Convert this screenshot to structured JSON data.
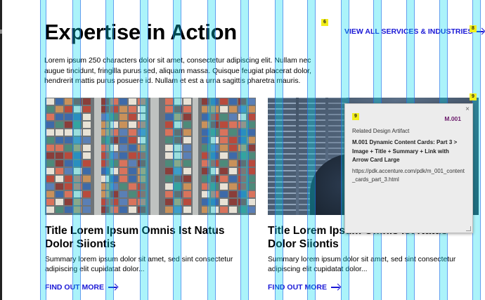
{
  "page": {
    "heading": "Expertise in Action",
    "view_all_label": "VIEW ALL SERVICES & INDUSTRIES",
    "intro": "Lorem ipsum 250 characters dolor sit amet, consectetur adipiscing elit. Nullam nec augue tincidunt, fringilla purus sed, aliquam massa. Quisque feugiat placerat dolor, hendrerit mattis purus posuere id. Nullam et est a urna sagittis pharetra mauris."
  },
  "cards": [
    {
      "title": "Title Lorem Ipsum Omnis Ist Natus Dolor Siiontis",
      "summary": "Summary lorem ipsum dolor sit amet, sed sint consectetur adipiscing elit cupidatat dolor...",
      "link_label": "FIND OUT MORE",
      "image": "shipping-containers-aerial"
    },
    {
      "title": "Title Lorem Ipsum Omnis Ist Natus Dolor Siiontis",
      "summary": "Summary lorem ipsum dolor sit amet, sed sint consectetur adipiscing elit cupidatat dolor...",
      "link_label": "FIND OUT MORE",
      "image": "city-buildings-person"
    }
  ],
  "annotations": {
    "badges": [
      "6",
      "8",
      "9"
    ],
    "artifact": {
      "badge": "9",
      "code": "M.001",
      "label": "Related Design Artifact",
      "name": "M.001 Dynamic Content Cards: Part 3 > Image + Title + Summary + Link with Arrow Card Large",
      "url": "https://pdk.accenture.com/pdk/m_001_content_cards_part_3.html",
      "close_glyph": "×"
    }
  },
  "colors": {
    "link": "#1a18d6",
    "grid_column": "#00dcf0",
    "badge": "#f2ee1a",
    "artifact_code": "#6b1b6b"
  },
  "icons": [
    "arrow-right-icon",
    "close-icon"
  ]
}
